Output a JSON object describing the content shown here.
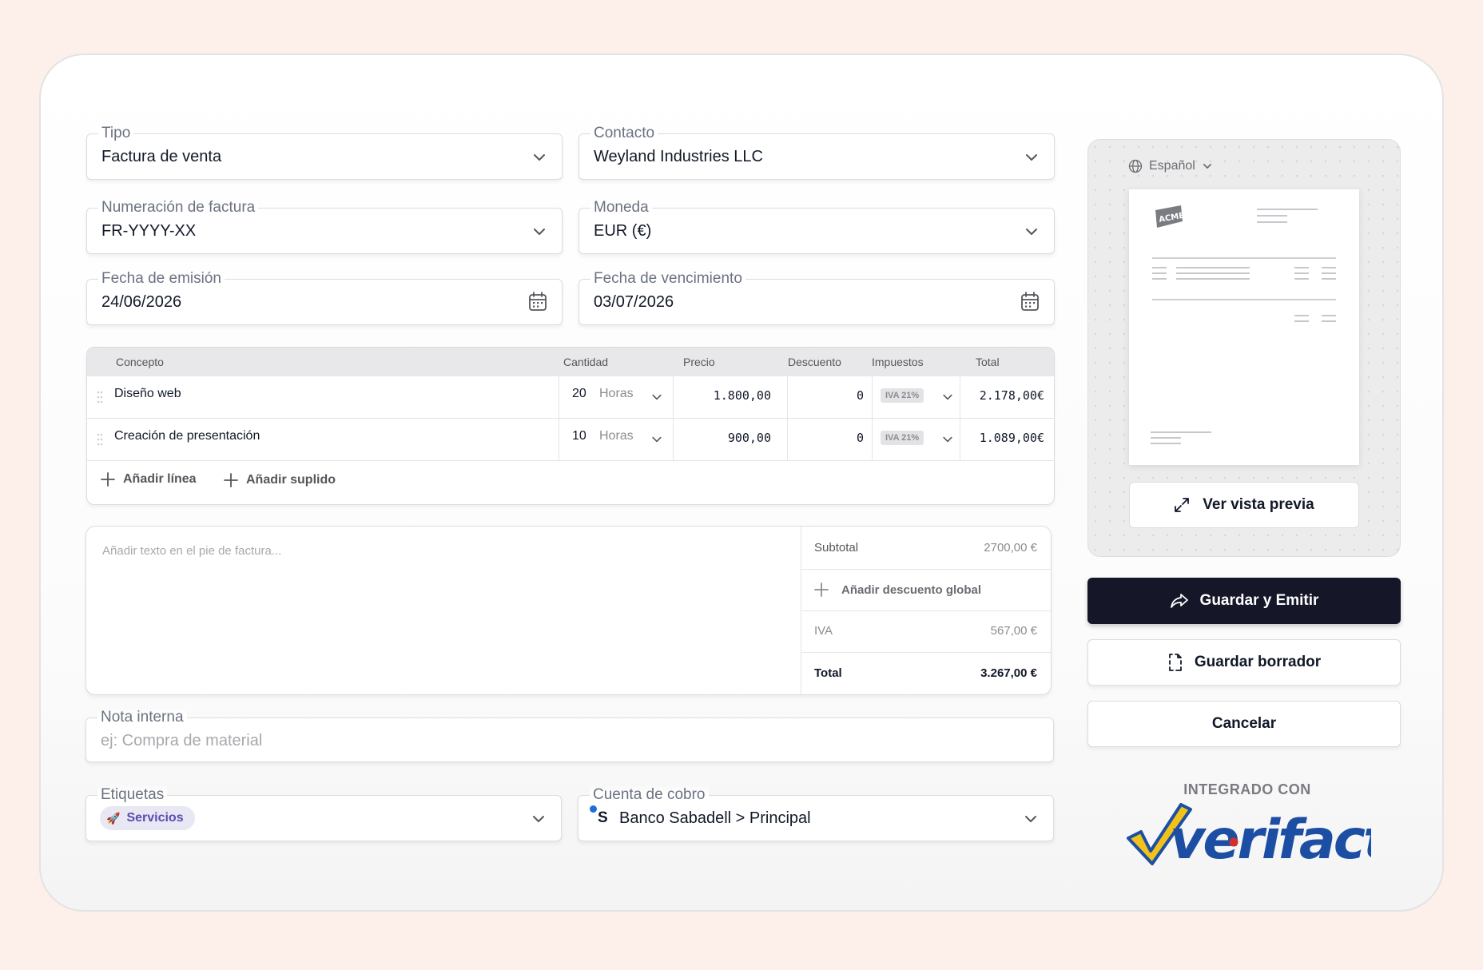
{
  "form": {
    "tipo": {
      "label": "Tipo",
      "value": "Factura de venta"
    },
    "contacto": {
      "label": "Contacto",
      "value": "Weyland Industries LLC"
    },
    "numeracion": {
      "label": "Numeración de factura",
      "value": "FR-YYYY-XX"
    },
    "moneda": {
      "label": "Moneda",
      "value": "EUR (€)"
    },
    "fecha_emision": {
      "label": "Fecha de emisión",
      "value": "24/06/2026"
    },
    "fecha_vencimiento": {
      "label": "Fecha de vencimiento",
      "value": "03/07/2026"
    }
  },
  "table": {
    "headers": [
      "Concepto",
      "Cantidad",
      "Precio",
      "Descuento",
      "Impuestos",
      "Total"
    ],
    "rows": [
      {
        "concepto": "Diseño web",
        "cantidad": "20",
        "unidad": "Horas",
        "precio": "1.800,00",
        "descuento": "0",
        "impuesto": "IVA 21%",
        "total": "2.178,00€"
      },
      {
        "concepto": "Creación de presentación",
        "cantidad": "10",
        "unidad": "Horas",
        "precio": "900,00",
        "descuento": "0",
        "impuesto": "IVA 21%",
        "total": "1.089,00€"
      }
    ],
    "add_line": "Añadir línea",
    "add_suplido": "Añadir suplido"
  },
  "footer": {
    "placeholder": "Añadir texto en el pie de factura...",
    "subtotal_label": "Subtotal",
    "subtotal_value": "2700,00 €",
    "discount_label": "Añadir descuento global",
    "iva_label": "IVA",
    "iva_value": "567,00 €",
    "total_label": "Total",
    "total_value": "3.267,00 €"
  },
  "nota": {
    "label": "Nota interna",
    "placeholder": "ej: Compra de material"
  },
  "etiquetas": {
    "label": "Etiquetas",
    "tag": "Servicios"
  },
  "cuenta": {
    "label": "Cuenta de cobro",
    "bank_initial": "S",
    "value": "Banco Sabadell > Principal"
  },
  "preview": {
    "language": "Español",
    "logo_text": "ACME",
    "button": "Ver vista previa"
  },
  "actions": {
    "save_emit": "Guardar y Emitir",
    "save_draft": "Guardar borrador",
    "cancel": "Cancelar"
  },
  "integration": {
    "label": "INTEGRADO CON",
    "brand": "verifactu"
  },
  "colors": {
    "accent_dark": "#151729",
    "background": "#fdf0ea",
    "tag_bg": "#e8e7f4",
    "brand_blue": "#1c4fa3",
    "brand_yellow": "#f1c21b",
    "brand_red": "#d32f2f"
  },
  "icons": [
    "chevron-down-icon",
    "calendar-icon",
    "drag-handle-icon",
    "plus-icon",
    "globe-icon",
    "expand-icon",
    "share-icon",
    "draft-icon",
    "rocket-icon",
    "bank-icon"
  ]
}
